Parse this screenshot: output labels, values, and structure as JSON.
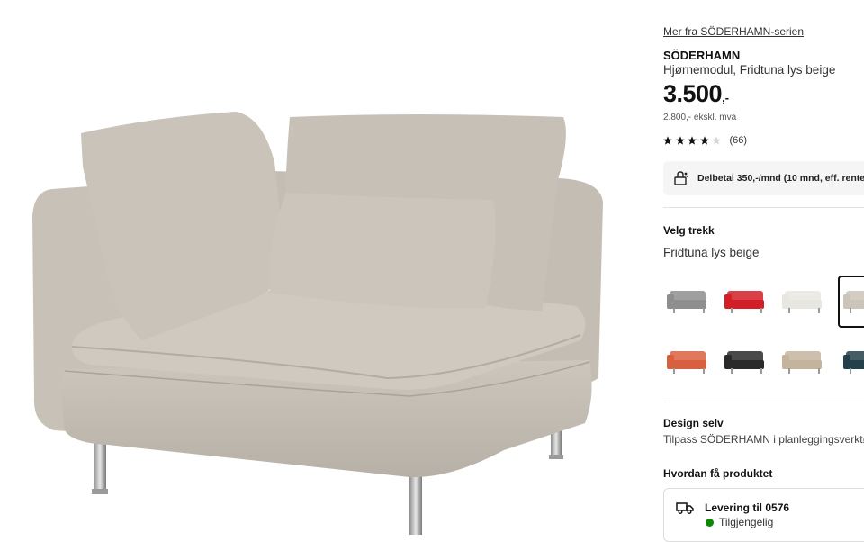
{
  "product": {
    "series_link": "Mer fra SÖDERHAMN-serien",
    "brand": "SÖDERHAMN",
    "description": "Hjørnemodul, Fridtuna lys beige",
    "price_main": "3.500",
    "price_suffix": ",-",
    "price_ex_vat": "2.800,- ekskl. mva",
    "rating": {
      "stars": 4,
      "max": 5,
      "count_label": "(66)"
    },
    "installment_text": "Delbetal 350,-/mnd (10 mnd, eff. rente"
  },
  "cover": {
    "title": "Velg trekk",
    "selected": "Fridtuna lys beige",
    "swatches": [
      {
        "name": "grey",
        "color": "#8e8e8e",
        "selected": false
      },
      {
        "name": "red",
        "color": "#d21f27",
        "selected": false
      },
      {
        "name": "white",
        "color": "#e8e6e0",
        "selected": false
      },
      {
        "name": "light-beige",
        "color": "#cbc4b8",
        "selected": true
      },
      {
        "name": "orange",
        "color": "#d9603f",
        "selected": false
      },
      {
        "name": "black",
        "color": "#2a2a2a",
        "selected": false
      },
      {
        "name": "beige",
        "color": "#c4b49d",
        "selected": false
      },
      {
        "name": "dark-teal",
        "color": "#24404a",
        "selected": false
      }
    ]
  },
  "design": {
    "title": "Design selv",
    "text": "Tilpass SÖDERHAMN i planleggingsverktøy"
  },
  "delivery": {
    "section_title": "Hvordan få produktet",
    "title": "Levering til 0576",
    "status": "Tilgjengelig",
    "status_color": "#0a8a00"
  },
  "icons": [
    "star-icon",
    "installment-icon",
    "truck-icon",
    "availability-dot-icon"
  ]
}
